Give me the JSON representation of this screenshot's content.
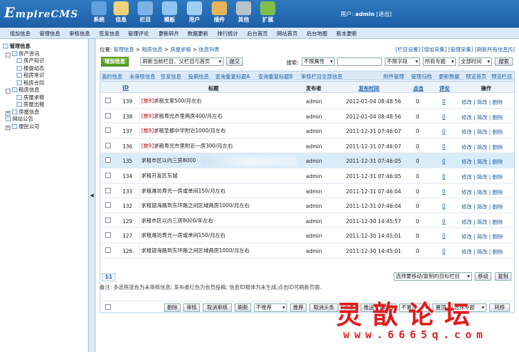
{
  "app": {
    "logo_first": "E",
    "logo_rest": "mpireCMS"
  },
  "top_icons": [
    {
      "label": "系统",
      "icon": "globe-icon",
      "color": "#5fa0e0"
    },
    {
      "label": "信息",
      "icon": "pencil-icon",
      "color": "#f3d17a"
    },
    {
      "label": "栏目",
      "icon": "folder-icon",
      "color": "#7db2e8"
    },
    {
      "label": "模板",
      "icon": "template-icon",
      "color": "#8fc5ef"
    },
    {
      "label": "用户",
      "icon": "user-icon",
      "color": "#9ed0f5"
    },
    {
      "label": "插件",
      "icon": "tools-icon",
      "color": "#e8b45a"
    },
    {
      "label": "其他",
      "icon": "gear-icon",
      "color": "#b9c3cc"
    },
    {
      "label": "扩展",
      "icon": "plus-icon",
      "color": "#7ec04a"
    }
  ],
  "user": {
    "prefix": "用户: ",
    "name": "admin",
    "logout": "[退出]"
  },
  "menu": [
    "增加信息",
    "管理信息",
    "审核信息",
    "签发信息",
    "管理评论",
    "更新碎片",
    "数据更新",
    "排行统计",
    "后台首页",
    "网站首页",
    "后台地图",
    "新本更新"
  ],
  "tree": [
    {
      "label": "管理信息",
      "level": 0,
      "bold": true
    },
    {
      "label": "房产资讯",
      "level": 1,
      "pm": "-"
    },
    {
      "label": "房产知识",
      "level": 2
    },
    {
      "label": "楼盘动态",
      "level": 2
    },
    {
      "label": "租房常识",
      "level": 2
    },
    {
      "label": "租房合同",
      "level": 2
    },
    {
      "label": "租房信息",
      "level": 1,
      "pm": "-"
    },
    {
      "label": "房屋求租",
      "level": 2
    },
    {
      "label": "房屋出租",
      "level": 2
    },
    {
      "label": "房屋信息",
      "level": 1,
      "pm": "+"
    },
    {
      "label": "网站公告",
      "level": 1
    },
    {
      "label": "便民公司",
      "level": 1,
      "pm": "+"
    }
  ],
  "split_arrow": "◀",
  "breadcrumb": {
    "label": "位置:",
    "items": [
      "管理信息",
      "租房信息",
      "房屋求租",
      "信息列表"
    ],
    "sep": " > "
  },
  "top_links": "[栏目设置] [增加采集] [管理采集] [刷新所有信息JS]",
  "toolbar": {
    "add_button": "增加信息",
    "refresh_select": "刷新当前栏目、父栏目与首页",
    "submit": "提交",
    "search_label": "搜索:",
    "attr_select": "不限属性",
    "search_value": "",
    "field_select": "不限字段",
    "topic_select": "所有专题",
    "time_select": "全部时间",
    "search_button": "搜索"
  },
  "bar2_left": [
    "我的信息",
    "未审核信息",
    "签发信息",
    "投稿信息",
    "查询重复标题A",
    "查询重复标题B",
    "审核栏目全部信息"
  ],
  "bar2_right": [
    "附件管理",
    "管理归档",
    "更新数据",
    "预览首页",
    "预览栏目"
  ],
  "columns": {
    "id": "ID",
    "title": "标题",
    "publisher": "发布者",
    "time": "发布时间",
    "clicks": "点击",
    "comments": "评论",
    "ops": "操作"
  },
  "rows": [
    {
      "id": "139",
      "tag": "[推9]",
      "title": "求租文家500/月左右",
      "publisher": "admin",
      "time": "2012-01-04 08:48:56",
      "clicks": "0",
      "comments": "0"
    },
    {
      "id": "138",
      "tag": "[推9]",
      "title": "求租寿光市里两房400/月左右",
      "publisher": "admin",
      "time": "2012-01-04 08:48:56",
      "clicks": "0",
      "comments": "0"
    },
    {
      "id": "137",
      "tag": "[推9]",
      "title": "求租圣都中学附近1000/月左右",
      "publisher": "admin",
      "time": "2011-12-31 07:46:07",
      "clicks": "0",
      "comments": "0"
    },
    {
      "id": "136",
      "tag": "[推9]",
      "title": "求租寿光市里附近一房300/月左右",
      "publisher": "admin",
      "time": "2011-12-31 07:46:07",
      "clicks": "0",
      "comments": "0"
    },
    {
      "id": "135",
      "tag": "",
      "title": "求租市区以内三房8000",
      "publisher": "admin",
      "time": "2011-12-31 07:46:05",
      "clicks": "0",
      "comments": "0",
      "highlight": true,
      "blur": true
    },
    {
      "id": "134",
      "tag": "",
      "title": "求租开发区东城",
      "publisher": "admin",
      "time": "2011-12-31 07:46:05",
      "clicks": "0",
      "comments": "0"
    },
    {
      "id": "133",
      "tag": "",
      "title": "求租潍坊寿光一房或单间150/月左右",
      "publisher": "admin",
      "time": "2011-12-31 07:46:04",
      "clicks": "0",
      "comments": "0"
    },
    {
      "id": "132",
      "tag": "",
      "title": "求租银海路到东环路之间区域两房1000/月左右",
      "publisher": "admin",
      "time": "2011-12-31 07:46:04",
      "clicks": "0",
      "comments": "0"
    },
    {
      "id": "129",
      "tag": "",
      "title": "求租市区以内三房8000/年左右",
      "publisher": "admin",
      "time": "2011-12-30 14:45:57",
      "clicks": "0",
      "comments": "0"
    },
    {
      "id": "127",
      "tag": "",
      "title": "求租潍坊寿光一房或单间150/月左右",
      "publisher": "admin",
      "time": "2011-12-30 14:45:01",
      "clicks": "0",
      "comments": "0"
    },
    {
      "id": "126",
      "tag": "",
      "title": "求租银海路到东环路之间区域两房1000/月左右",
      "publisher": "admin",
      "time": "2011-12-30 14:45:01",
      "clicks": "0",
      "comments": "0"
    }
  ],
  "row_ops": {
    "edit": "修改",
    "quick_edit": "简改",
    "delete": "删除",
    "sep": " | "
  },
  "bottom_buttons": [
    "删除",
    "审核",
    "取消审核",
    "刷新",
    "不推荐",
    "推荐",
    "取消头条",
    "头条",
    "推送",
    "归档",
    "不置顶",
    "置顶",
    "选择专题",
    "转移"
  ],
  "bottom_selects": {
    "recommend": "不推荐",
    "top": "不置顶",
    "topic": "选择专题"
  },
  "count": "11",
  "move_select": "选择要移动/复制的目标栏目",
  "move_button": "移动",
  "copy_button": "复制",
  "footnote": "备注: 多选框蓝色为未审核信息; 发布者红色为会员投稿; 信息ID粗体为未生成,点击ID可刷新页面.",
  "watermark": {
    "line1": "灵歆论坛",
    "line2": "www.6665q.com"
  }
}
